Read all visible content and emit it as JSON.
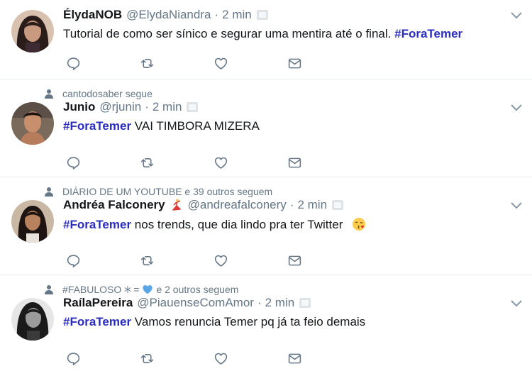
{
  "tweets": [
    {
      "social": "",
      "name": "ÉlydaNOB",
      "handle": "@ElydaNiandra",
      "separator": "·",
      "time": "2 min",
      "text_before": "Tutorial de como ser sínico e segurar uma mentira até o final.",
      "hashtag": "#ForaTemer",
      "text_after": ""
    },
    {
      "social": "cantodosaber segue",
      "name": "Junio",
      "handle": "@rjunin",
      "separator": "·",
      "time": "2 min",
      "hashtag": "#ForaTemer",
      "text_after": "VAI TIMBORA MIZERA"
    },
    {
      "social": "DIÁRIO DE UM YOUTUBE e 39 outros seguem",
      "name": "Andréa Falconery",
      "name_emoji": "dancer-emoji",
      "handle": "@andreafalconery",
      "separator": "·",
      "time": "2 min",
      "hashtag": "#ForaTemer",
      "text_after": "nos trends, que dia lindo pra ter Twitter",
      "text_emoji": "kiss-emoji"
    },
    {
      "social_before": "#FABULOSO",
      "social_middle": "=",
      "social_after": "e 2 outros seguem",
      "name": "RaílaPereira",
      "handle": "@PiauenseComAmor",
      "separator": "·",
      "time": "2 min",
      "hashtag": "#ForaTemer",
      "text_after": "Vamos renuncia Temer pq já ta feio demais"
    }
  ],
  "icons": [
    "reply-icon",
    "retweet-icon",
    "like-icon",
    "dm-icon",
    "chevron-down-icon",
    "person-icon"
  ],
  "colors": {
    "hashtag": "#2b2dbf",
    "muted": "#657786",
    "icon": "#657786",
    "divider": "#e6ecf0",
    "heart": "#5aa7e8"
  }
}
